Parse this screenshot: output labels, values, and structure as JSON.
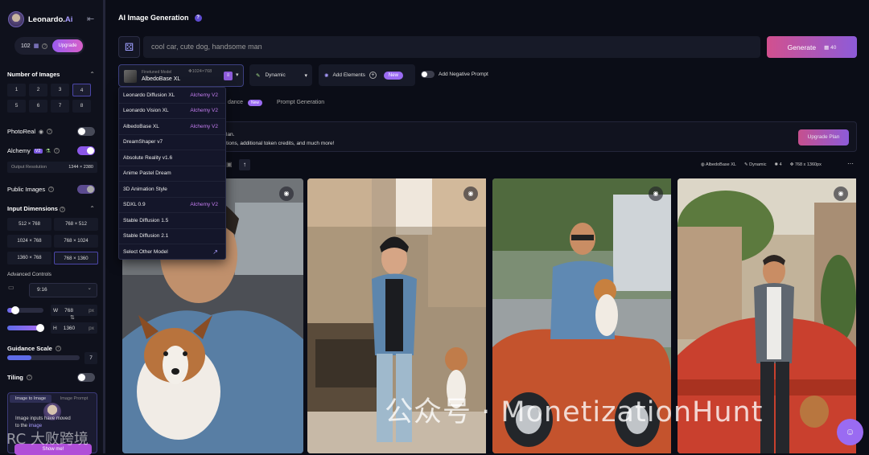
{
  "sidebar": {
    "brand": "Leonardo.",
    "brand_accent": "Ai",
    "tokens": "102",
    "upgrade": "Upgrade",
    "num_images_title": "Number of Images",
    "num_images": [
      "1",
      "2",
      "3",
      "4",
      "5",
      "6",
      "7",
      "8"
    ],
    "photoreal": "PhotoReal",
    "alchemy": "Alchemy",
    "alchemy_badge": "V2",
    "output_res_label": "Output Resolution",
    "output_res_value": "1344 × 2380",
    "public_images": "Public Images",
    "input_dims_title": "Input Dimensions",
    "dims": [
      "512 × 768",
      "768 × 512",
      "1024 × 768",
      "768 × 1024",
      "1360 × 768",
      "768 × 1360"
    ],
    "advanced": "Advanced Controls",
    "ratio": "9:16",
    "w_label": "W",
    "w_value": "768",
    "h_label": "H",
    "h_value": "1360",
    "px": "px",
    "guidance_title": "Guidance Scale",
    "guidance_value": "7",
    "tiling": "Tiling",
    "i2i_tabs": [
      "Image to Image",
      "Image Prompt"
    ],
    "i2i_msg_a": "Image inputs have moved",
    "i2i_msg_b": "to the",
    "i2i_msg_link": "image",
    "showme": "Show me!"
  },
  "header": {
    "title": "AI Image Generation",
    "help": "?"
  },
  "prompt": {
    "placeholder": "cool car, cute dog, handsome man",
    "generate": "Generate",
    "cost": "40"
  },
  "model": {
    "sub": "Finetuned Model",
    "res": "1024×768",
    "name": "AlbedoBase XL"
  },
  "style": "Dynamic",
  "elements": {
    "label": "Add Elements",
    "new": "New"
  },
  "negative": "Add Negative Prompt",
  "tabs": {
    "t1": "dance",
    "t1_badge": "New",
    "t2": "Prompt Generation"
  },
  "banner": {
    "line1": "lan.",
    "line2": "tions, additional token credits, and much more!",
    "button": "Upgrade Plan"
  },
  "meta": {
    "model": "AlbedoBase XL",
    "style": "Dynamic",
    "count": "4",
    "size": "768 x 1360px"
  },
  "dropdown": [
    {
      "name": "Leonardo Diffusion XL",
      "tag": "Alchemy V2"
    },
    {
      "name": "Leonardo Vision XL",
      "tag": "Alchemy V2"
    },
    {
      "name": "AlbedoBase XL",
      "tag": "Alchemy V2"
    },
    {
      "name": "DreamShaper v7",
      "tag": ""
    },
    {
      "name": "Absolute Reality v1.6",
      "tag": ""
    },
    {
      "name": "Anime Pastel Dream",
      "tag": ""
    },
    {
      "name": "3D Animation Style",
      "tag": ""
    },
    {
      "name": "SDXL 0.9",
      "tag": "Alchemy V2"
    },
    {
      "name": "Stable Diffusion 1.5",
      "tag": ""
    },
    {
      "name": "Stable Diffusion 2.1",
      "tag": ""
    },
    {
      "name": "Select Other Model",
      "tag": ""
    }
  ],
  "watermark": "公众号 · MonetizationHunt",
  "watermark2": "RC 大败跨境",
  "colors": {
    "accent": "#8b57e8",
    "bg": "#0b0d17",
    "generate_from": "#d2508e",
    "generate_to": "#8d5bd9"
  }
}
